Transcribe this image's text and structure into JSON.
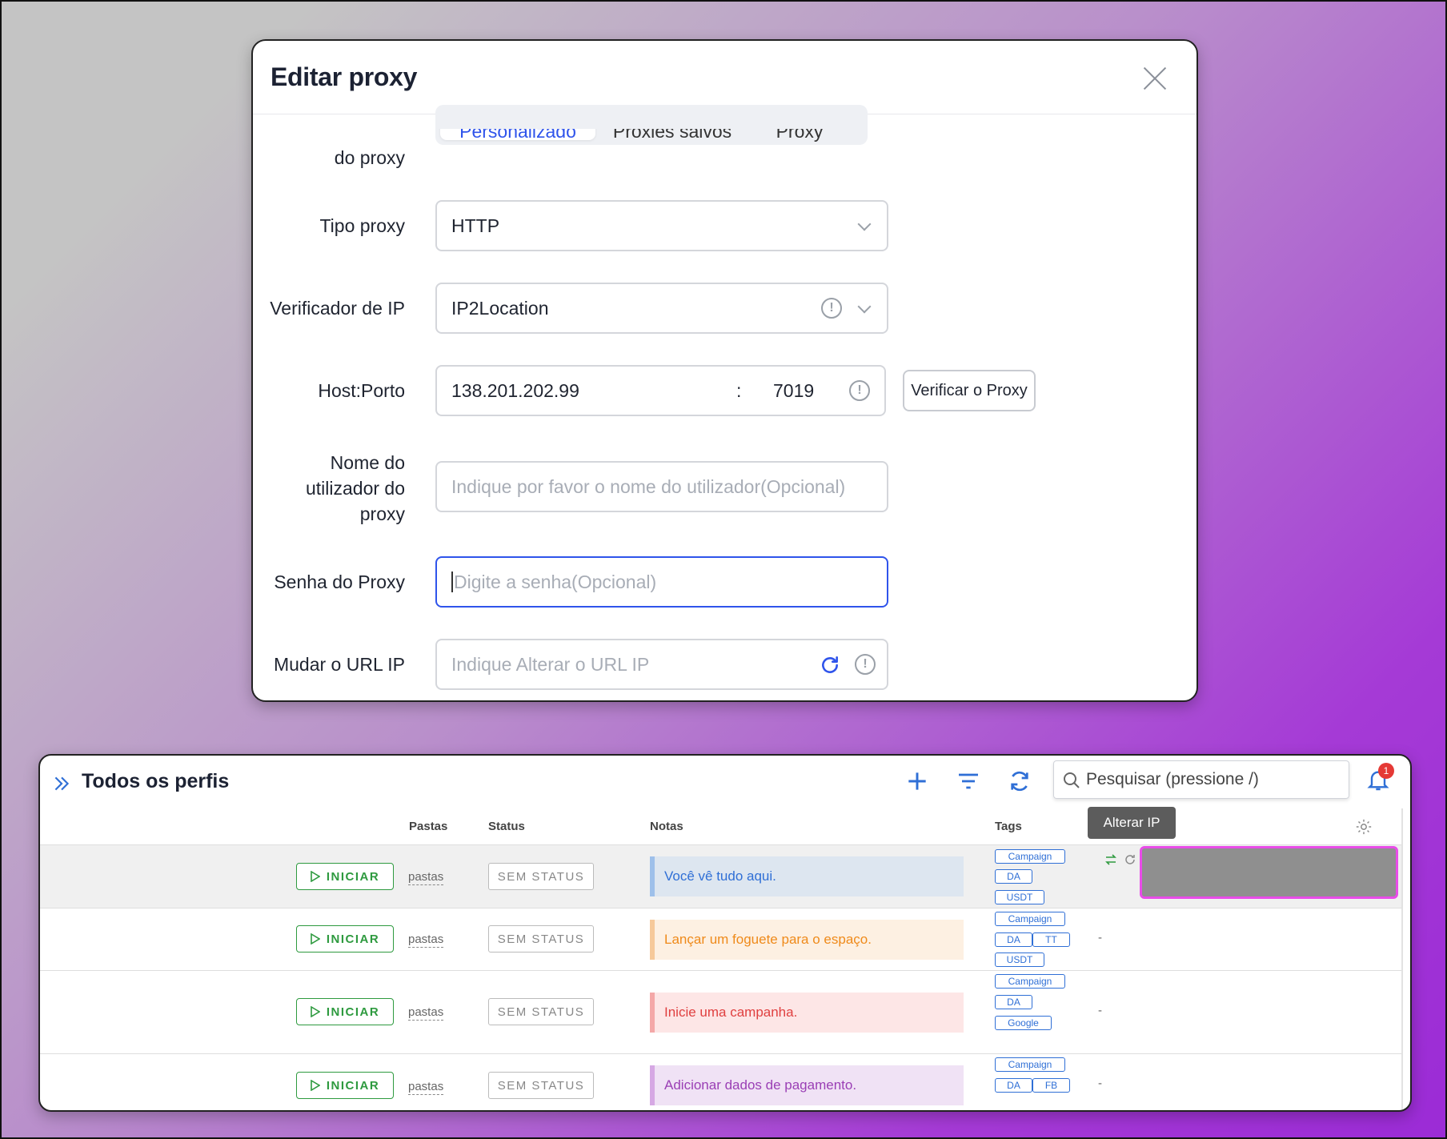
{
  "modal": {
    "title": "Editar proxy",
    "source_label": "do proxy",
    "source_tabs": [
      {
        "label": "Personalizado",
        "active": true
      },
      {
        "label": "Proxies salvos",
        "active": false
      },
      {
        "label": "Proxy",
        "active": false
      }
    ],
    "type_label": "Tipo proxy",
    "type_value": "HTTP",
    "checker_label": "Verificador de IP",
    "checker_value": "IP2Location",
    "host_label": "Host:Porto",
    "host_value": "138.201.202.99",
    "host_separator": ":",
    "port_value": "7019",
    "verify_button": "Verificar o Proxy",
    "username_label_lines": [
      "Nome do",
      "utilizador do",
      "proxy"
    ],
    "username_placeholder": "Indique por favor o nome do utilizador(Opcional)",
    "password_label": "Senha do Proxy",
    "password_placeholder": "Digite a senha(Opcional)",
    "change_url_label": "Mudar o URL IP",
    "change_url_placeholder": "Indique Alterar o URL IP",
    "accent_color": "#2f54eb"
  },
  "panel": {
    "title": "Todos os perfis",
    "search_placeholder": "Pesquisar (pressione /)",
    "notification_count": "1",
    "tooltip": "Alterar IP",
    "columns": {
      "folders": "Pastas",
      "status": "Status",
      "notes": "Notas",
      "tags": "Tags"
    },
    "rows": [
      {
        "start": "INICIAR",
        "folder": "pastas",
        "status": "SEM STATUS",
        "note": "Você vê tudo aqui.",
        "note_color": "#2f6fd6",
        "note_bg": "#dde6f0",
        "tags": [
          [
            "Campaign"
          ],
          [
            "DA"
          ],
          [
            "USDT"
          ]
        ],
        "proxy": ""
      },
      {
        "start": "INICIAR",
        "folder": "pastas",
        "status": "SEM STATUS",
        "note": "Lançar um foguete para o espaço.",
        "note_color": "#ef8a1a",
        "note_bg": "#fdf0e2",
        "tags": [
          [
            "Campaign"
          ],
          [
            "DA",
            "TT"
          ],
          [
            "USDT"
          ]
        ],
        "proxy": "-"
      },
      {
        "start": "INICIAR",
        "folder": "pastas",
        "status": "SEM STATUS",
        "note": "Inicie uma campanha.",
        "note_color": "#e04040",
        "note_bg": "#fde6e6",
        "tags": [
          [
            "Campaign"
          ],
          [
            "DA"
          ],
          [
            "Google"
          ]
        ],
        "proxy": "-"
      },
      {
        "start": "INICIAR",
        "folder": "pastas",
        "status": "SEM STATUS",
        "note": "Adicionar dados de pagamento.",
        "note_color": "#9a3fb5",
        "note_bg": "#f0e2f5",
        "tags": [
          [
            "Campaign"
          ],
          [
            "DA",
            "FB"
          ]
        ],
        "proxy": "-"
      }
    ]
  }
}
